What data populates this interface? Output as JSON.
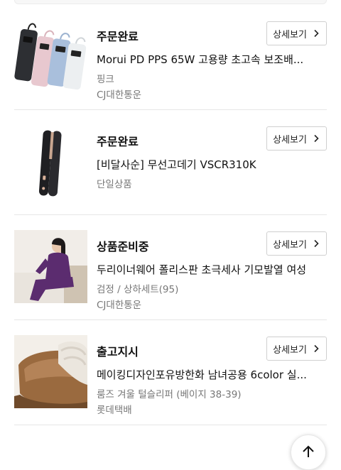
{
  "orders": [
    {
      "status": "주문완료",
      "product_name": "Morui PD PPS 65W 고용량 초고속 보조배...",
      "option": "핑크",
      "carrier": "CJ대한통운",
      "detail_button": "상세보기",
      "thumbnail": "power-bank-image"
    },
    {
      "status": "주문완료",
      "product_name": "[비달사순] 무선고데기 VSCR310K",
      "option": "단일상품",
      "carrier": "",
      "detail_button": "상세보기",
      "thumbnail": "hair-straightener-image"
    },
    {
      "status": "상품준비중",
      "product_name": "두리이너웨어 폴리스판 초극세사 기모발열 여성...",
      "option": "검정 / 상하세트(95)",
      "carrier": "CJ대한통운",
      "detail_button": "상세보기",
      "thumbnail": "thermal-underwear-image"
    },
    {
      "status": "출고지시",
      "product_name": "메이킹디자인포유방한화 남녀공용 6color 실...",
      "option": "룸즈 겨울 털슬리퍼 (베이지 38-39)",
      "carrier": "롯데택배",
      "detail_button": "상세보기",
      "thumbnail": "fur-slipper-image"
    }
  ],
  "scroll_top_icon": "arrow-up-icon"
}
